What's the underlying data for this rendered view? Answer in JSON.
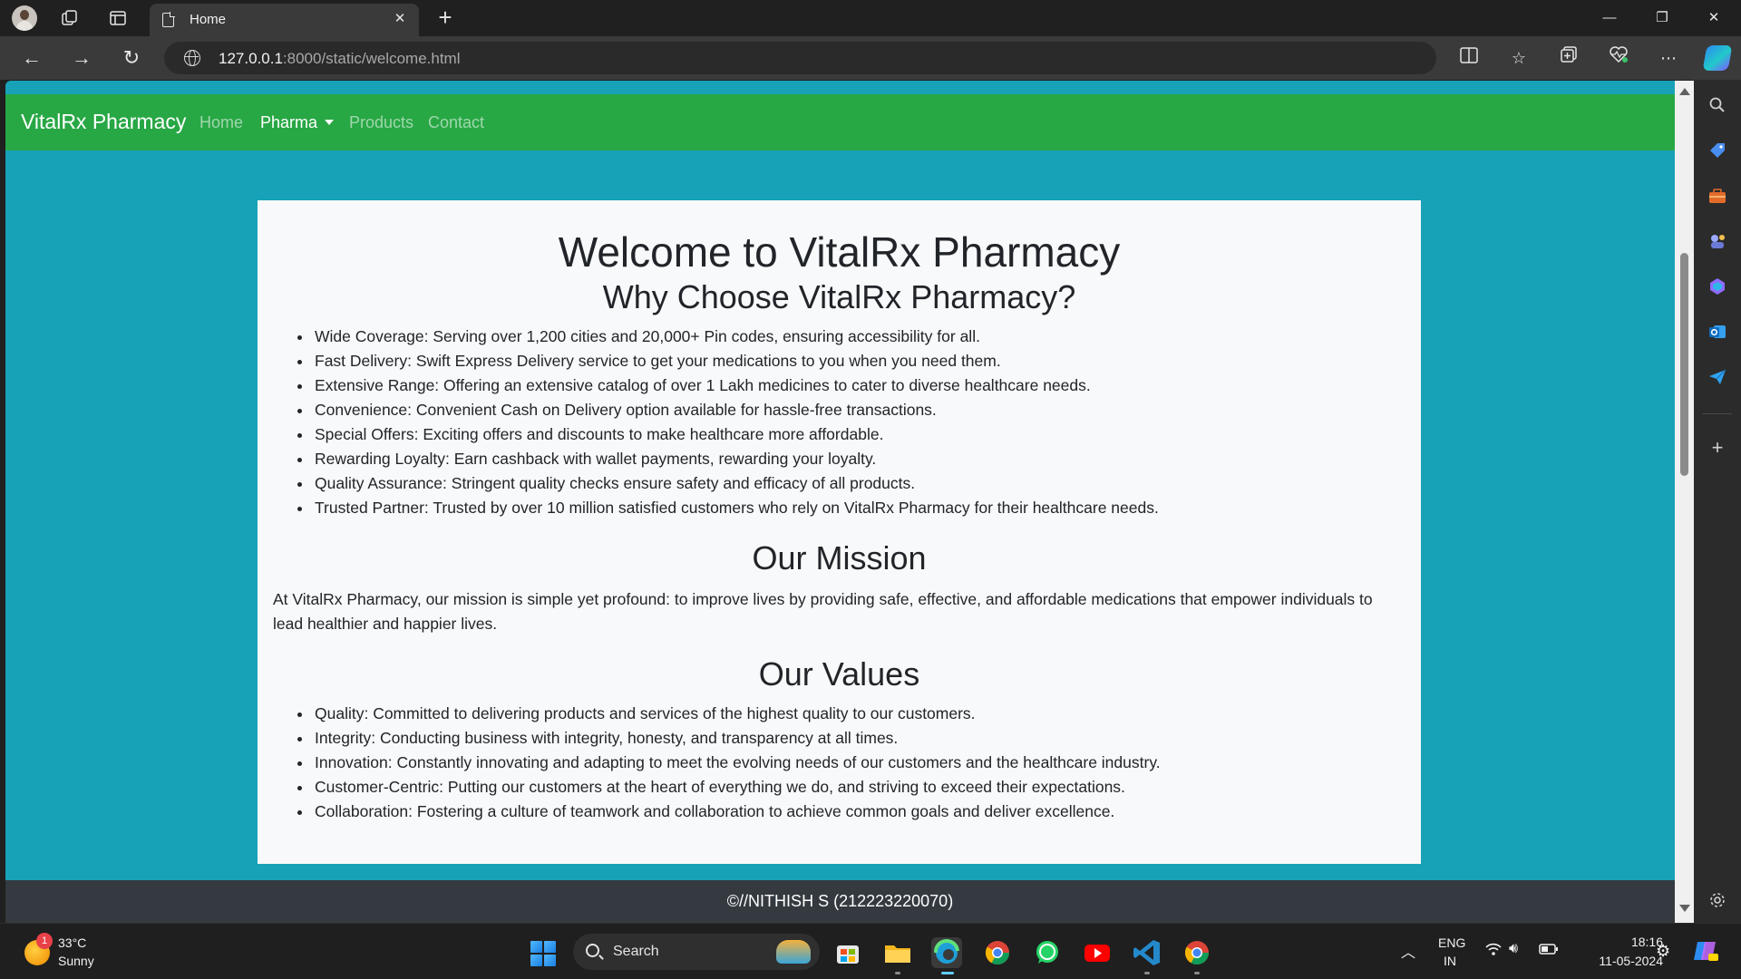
{
  "browser": {
    "tab_title": "Home",
    "url_host": "127.0.0.1",
    "url_path": ":8000/static/welcome.html",
    "window_controls": {
      "minimize": "—",
      "restore": "❐",
      "close": "✕"
    }
  },
  "site": {
    "brand": "VitalRx Pharmacy",
    "nav": [
      "Home",
      "Pharma",
      "Products",
      "Contact"
    ],
    "colors": {
      "navbar": "#28a745",
      "page_bg": "#17a2b8",
      "card_bg": "#f8f9fa",
      "footer": "#343a40"
    }
  },
  "content": {
    "title": "Welcome to VitalRx Pharmacy",
    "why_heading": "Why Choose VitalRx Pharmacy?",
    "why_items": [
      "Wide Coverage: Serving over 1,200 cities and 20,000+ Pin codes, ensuring accessibility for all.",
      "Fast Delivery: Swift Express Delivery service to get your medications to you when you need them.",
      "Extensive Range: Offering an extensive catalog of over 1 Lakh medicines to cater to diverse healthcare needs.",
      "Convenience: Convenient Cash on Delivery option available for hassle-free transactions.",
      "Special Offers: Exciting offers and discounts to make healthcare more affordable.",
      "Rewarding Loyalty: Earn cashback with wallet payments, rewarding your loyalty.",
      "Quality Assurance: Stringent quality checks ensure safety and efficacy of all products.",
      "Trusted Partner: Trusted by over 10 million satisfied customers who rely on VitalRx Pharmacy for their healthcare needs."
    ],
    "mission_heading": "Our Mission",
    "mission_text": "At VitalRx Pharmacy, our mission is simple yet profound: to improve lives by providing safe, effective, and affordable medications that empower individuals to lead healthier and happier lives.",
    "values_heading": "Our Values",
    "values_items": [
      "Quality: Committed to delivering products and services of the highest quality to our customers.",
      "Integrity: Conducting business with integrity, honesty, and transparency at all times.",
      "Innovation: Constantly innovating and adapting to meet the evolving needs of our customers and the healthcare industry.",
      "Customer-Centric: Putting our customers at the heart of everything we do, and striving to exceed their expectations.",
      "Collaboration: Fostering a culture of teamwork and collaboration to achieve common goals and deliver excellence."
    ]
  },
  "footer": {
    "text": "©//NITHISH S (212223220070)"
  },
  "taskbar": {
    "weather_badge": "1",
    "temperature": "33°C",
    "condition": "Sunny",
    "search_label": "Search",
    "lang_top": "ENG",
    "lang_bottom": "IN",
    "time": "18:16",
    "date": "11-05-2024"
  }
}
